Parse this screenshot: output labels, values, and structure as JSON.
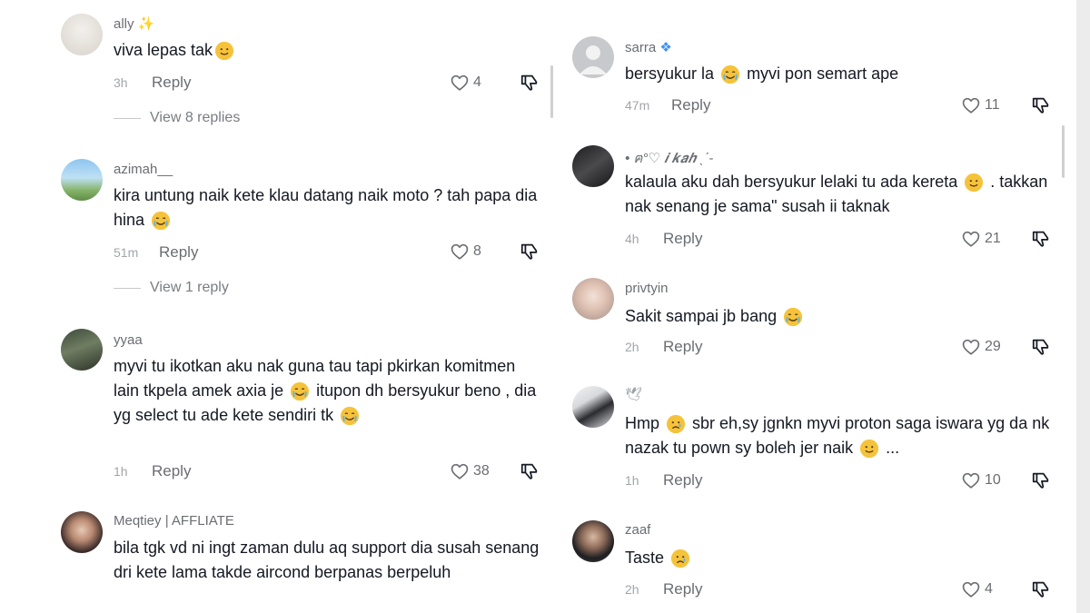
{
  "left_comments": [
    {
      "username": "ally",
      "username_emoji": "sparkle",
      "text": "viva lepas tak",
      "text_emoji": "grin-sweat",
      "time": "3h",
      "reply": "Reply",
      "likes": "4",
      "view_replies": "View 8 replies"
    },
    {
      "username": "azimah__",
      "text": "kira untung naik kete klau datang naik moto ? tah papa dia hina",
      "text_emoji": "sob",
      "time": "51m",
      "reply": "Reply",
      "likes": "8",
      "view_replies": "View 1 reply"
    },
    {
      "username": "yyaa",
      "text_parts": [
        "myvi tu ikotkan aku nak guna tau tapi pkirkan komitmen lain tkpela amek axia je ",
        "itupon dh bersyukur beno , dia yg select tu ade kete sendiri tk"
      ],
      "time": "1h",
      "reply": "Reply",
      "likes": "38"
    },
    {
      "username": "Meqtiey | AFFLIATE",
      "text": "bila tgk vd ni ingt zaman dulu aq support dia susah senang dri kete lama takde aircond berpanas berpeluh"
    }
  ],
  "right_comments": [
    {
      "username": "sarra",
      "username_emoji": "butterfly",
      "text_parts": [
        "bersyukur la ",
        "myvi pon semart ape"
      ],
      "time": "47m",
      "reply": "Reply",
      "likes": "11"
    },
    {
      "username": "• ฅ°♡ 𝒊 𝒌𝒂𝒉 ˎˊ-",
      "text_parts": [
        "kalaula aku dah bersyukur lelaki tu ada kereta ",
        ". takkan nak senang je sama\" susah ii taknak"
      ],
      "time": "4h",
      "reply": "Reply",
      "likes": "21"
    },
    {
      "username": "privtyin",
      "text": "Sakit sampai jb bang",
      "time": "2h",
      "reply": "Reply",
      "likes": "29"
    },
    {
      "username": "",
      "username_emoji": "dove",
      "text_parts": [
        "Hmp ",
        "sbr eh,sy jgnkn myvi proton saga iswara yg da nk nazak tu pown sy boleh jer naik ",
        "..."
      ],
      "time": "1h",
      "reply": "Reply",
      "likes": "10"
    },
    {
      "username": "zaaf",
      "text": "Taste",
      "time": "2h",
      "reply": "Reply",
      "likes": "4"
    }
  ],
  "colors": {
    "text": "#161823",
    "muted": "#6b6d73",
    "time": "#a3a5ab",
    "emoji": "#f5c33b"
  }
}
